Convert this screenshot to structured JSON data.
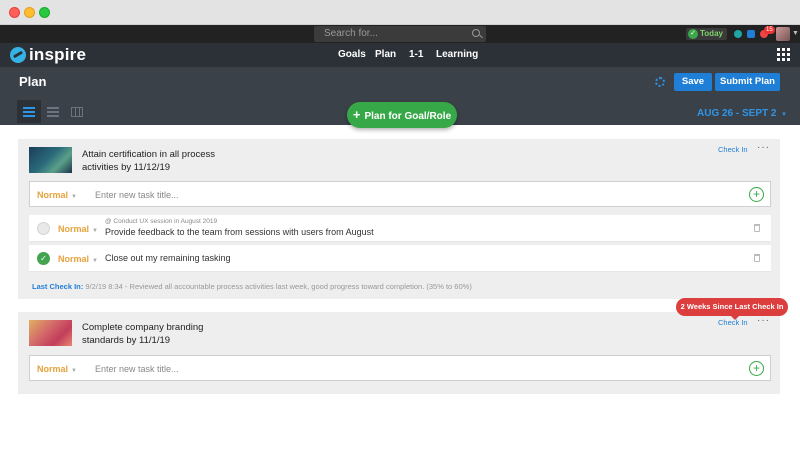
{
  "topbar": {
    "search_placeholder": "Search for...",
    "today_label": "Today",
    "notification_count": "15"
  },
  "nav": {
    "brand": "inspire",
    "links": [
      "Goals",
      "Plan",
      "1-1",
      "Learning"
    ]
  },
  "header": {
    "title": "Plan",
    "save_label": "Save",
    "submit_label": "Submit Plan",
    "plan_button_label": "Plan for Goal/Role",
    "date_range": "AUG 26 - SEPT 2"
  },
  "goals": [
    {
      "title": "Attain certification in all process activities by 11/12/19",
      "checkin_label": "Check In",
      "new_task": {
        "priority": "Normal",
        "placeholder": "Enter new task title..."
      },
      "tasks": [
        {
          "priority": "Normal",
          "context": "@ Conduct UX session in August 2019",
          "text": "Provide feedback to the team from sessions with users from August",
          "done": false
        },
        {
          "priority": "Normal",
          "context": "",
          "text": "Close out my remaining tasking",
          "done": true
        }
      ],
      "last_checkin_label": "Last Check In:",
      "last_checkin_text": "9/2/19 8:34 - Reviewed all accountable process activities last week, good progress toward completion. (35% to 60%)"
    },
    {
      "title": "Complete company branding standards by 11/1/19",
      "checkin_label": "Check In",
      "badge": "2 Weeks Since Last Check In",
      "new_task": {
        "priority": "Normal",
        "placeholder": "Enter new task title..."
      }
    }
  ],
  "colors": {
    "accent_blue": "#1f7fd6",
    "plan_green": "#37a847",
    "priority_orange": "#e6a23c",
    "badge_red": "#dc3d3d"
  }
}
